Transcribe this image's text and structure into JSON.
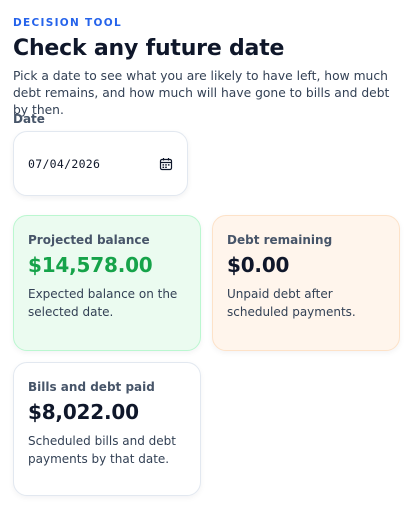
{
  "header": {
    "eyebrow": "DECISION TOOL",
    "title": "Check any future date",
    "subtitle": "Pick a date to see what you are likely to have left, how much debt remains, and how much will have gone to bills and debt by then."
  },
  "date_field": {
    "label": "Date",
    "value": "07/04/2026",
    "icon": "calendar-icon"
  },
  "cards": [
    {
      "label": "Projected balance",
      "value": "$14,578.00",
      "description": "Expected balance on the selected date.",
      "value_color": "#16a34a",
      "background": "#ebfbf0"
    },
    {
      "label": "Debt remaining",
      "value": "$0.00",
      "description": "Unpaid debt after scheduled payments.",
      "background": "#fff5ec"
    },
    {
      "label": "Bills and debt paid",
      "value": "$8,022.00",
      "description": "Scheduled bills and debt payments by that date.",
      "background": "#ffffff"
    }
  ],
  "colors": {
    "accent": "#2563eb",
    "positive": "#16a34a"
  }
}
